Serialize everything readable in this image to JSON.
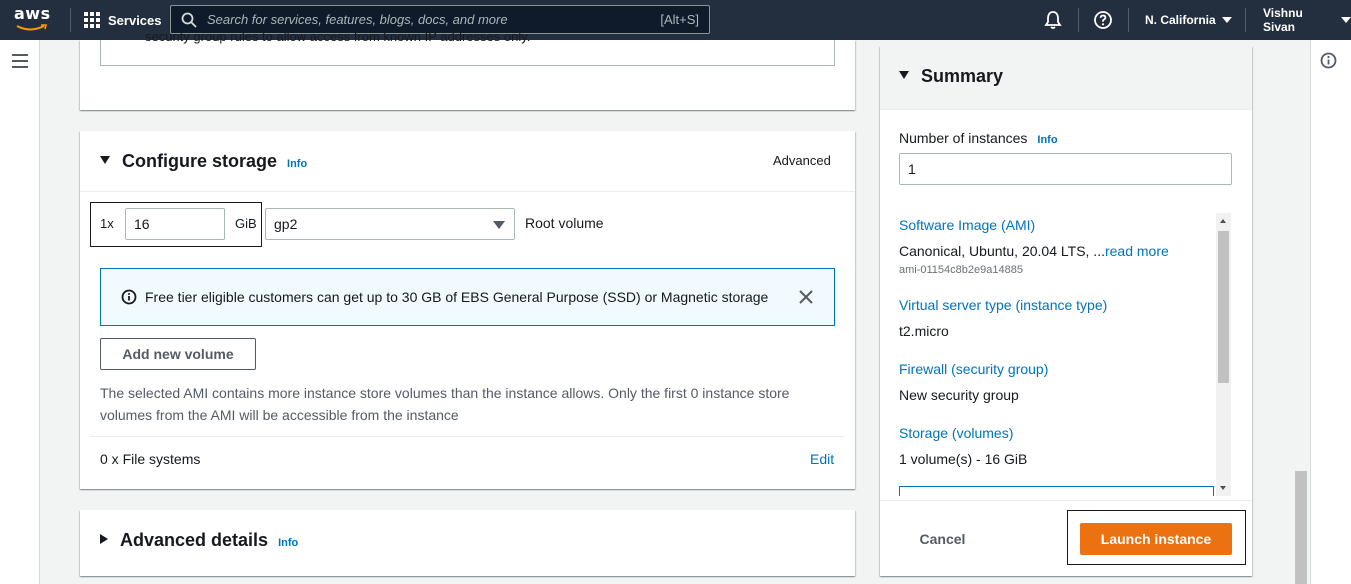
{
  "topnav": {
    "logo_text": "aws",
    "services_label": "Services",
    "search_placeholder": "Search for services, features, blogs, docs, and more",
    "search_shortcut": "[Alt+S]",
    "region": "N. California",
    "user": "Vishnu Sivan"
  },
  "top_card": {
    "cut_text": "security group rules to allow access from known IP addresses only."
  },
  "storage": {
    "title": "Configure storage",
    "info": "Info",
    "advanced_link": "Advanced",
    "multiplier": "1x",
    "size_value": "16",
    "size_unit": "GiB",
    "volume_type": "gp2",
    "volume_label": "Root volume",
    "alert_text": "Free tier eligible customers can get up to 30 GB of EBS General Purpose (SSD) or Magnetic storage",
    "add_volume_label": "Add new volume",
    "note_text": "The selected AMI contains more instance store volumes than the instance allows. Only the first 0 instance store volumes from the AMI will be accessible from the instance",
    "file_systems": "0 x File systems",
    "edit_link": "Edit"
  },
  "advanced_details": {
    "title": "Advanced details",
    "info": "Info"
  },
  "summary": {
    "title": "Summary",
    "instances_label": "Number of instances",
    "instances_info": "Info",
    "instances_value": "1",
    "ami_label": "Software Image (AMI)",
    "ami_value": "Canonical, Ubuntu, 20.04 LTS, ...",
    "ami_read_more": "read more",
    "ami_id": "ami-01154c8b2e9a14885",
    "instance_type_label": "Virtual server type (instance type)",
    "instance_type_value": "t2.micro",
    "firewall_label": "Firewall (security group)",
    "firewall_value": "New security group",
    "storage_label": "Storage (volumes)",
    "storage_value": "1 volume(s) - 16 GiB",
    "cancel_label": "Cancel",
    "launch_label": "Launch instance"
  },
  "colors": {
    "nav_bg": "#232f3e",
    "link": "#0073bb",
    "primary": "#ec7211",
    "alert_bg": "#f1faff"
  }
}
